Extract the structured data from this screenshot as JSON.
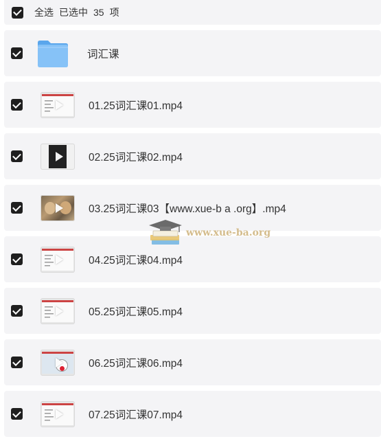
{
  "header": {
    "select_all_label": "全选",
    "selected_prefix": "已选中",
    "selected_count": "35",
    "selected_suffix": "项",
    "all_checked": true
  },
  "items": [
    {
      "name": "词汇课",
      "kind": "folder",
      "checked": true,
      "icon": "folder-icon"
    },
    {
      "name": "01.25词汇课01.mp4",
      "kind": "video",
      "checked": true,
      "thumb": "screen"
    },
    {
      "name": "02.25词汇课02.mp4",
      "kind": "video",
      "checked": true,
      "thumb": "dark"
    },
    {
      "name": "03.25词汇课03【www.xue-b a .org】.mp4",
      "kind": "video",
      "checked": true,
      "thumb": "pets"
    },
    {
      "name": "04.25词汇课04.mp4",
      "kind": "video",
      "checked": true,
      "thumb": "screen"
    },
    {
      "name": "05.25词汇课05.mp4",
      "kind": "video",
      "checked": true,
      "thumb": "screen"
    },
    {
      "name": "06.25词汇课06.mp4",
      "kind": "video",
      "checked": true,
      "thumb": "cartoon"
    },
    {
      "name": "07.25词汇课07.mp4",
      "kind": "video",
      "checked": true,
      "thumb": "screen"
    }
  ],
  "watermark": {
    "text": "www.xue-ba.org",
    "icon": "graduation-cap-books-logo"
  },
  "colors": {
    "row_background": "#f4f4f6",
    "checkbox": "#1f1f1f",
    "folder_blue": "#7bbcf5",
    "text": "#333333"
  }
}
